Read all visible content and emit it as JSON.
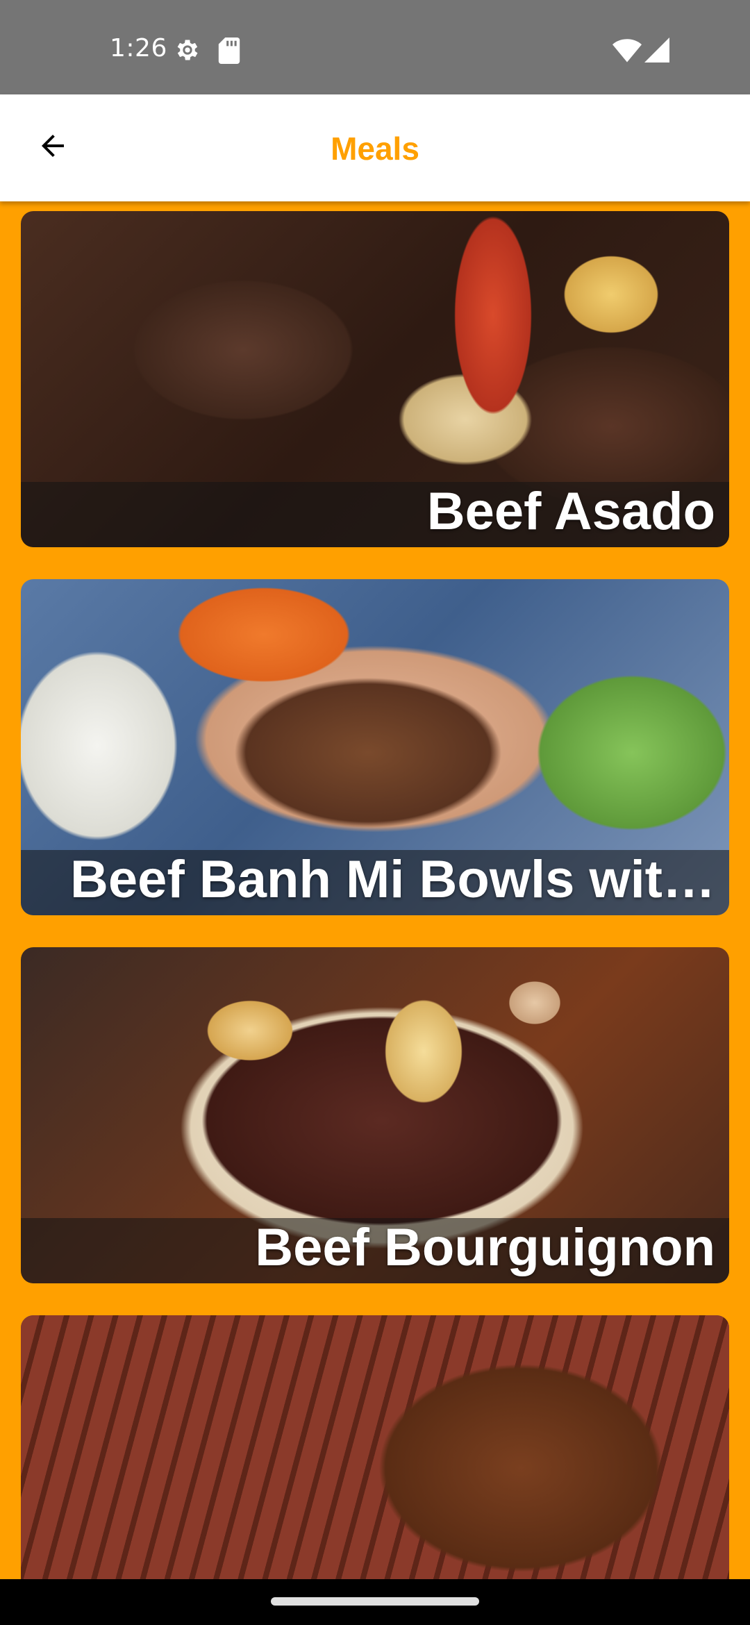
{
  "status_bar": {
    "time": "1:26",
    "icons": [
      "gear-icon",
      "sd-card-icon",
      "wifi-icon",
      "cell-signal-icon"
    ]
  },
  "app_bar": {
    "title": "Meals",
    "back_icon": "arrow-left-icon",
    "title_color": "#FFA000"
  },
  "theme": {
    "background": "#FFA000",
    "status_bar_bg": "#757575",
    "app_bar_bg": "#FFFFFF"
  },
  "meals": [
    {
      "name": "Beef Asado",
      "image": "beef-asado-photo"
    },
    {
      "name": "Beef Banh Mi Bowls wit…",
      "image": "beef-banh-mi-bowls-photo"
    },
    {
      "name": "Beef Bourguignon",
      "image": "beef-bourguignon-photo"
    },
    {
      "name": "",
      "image": "beef-brisket-photo"
    }
  ]
}
